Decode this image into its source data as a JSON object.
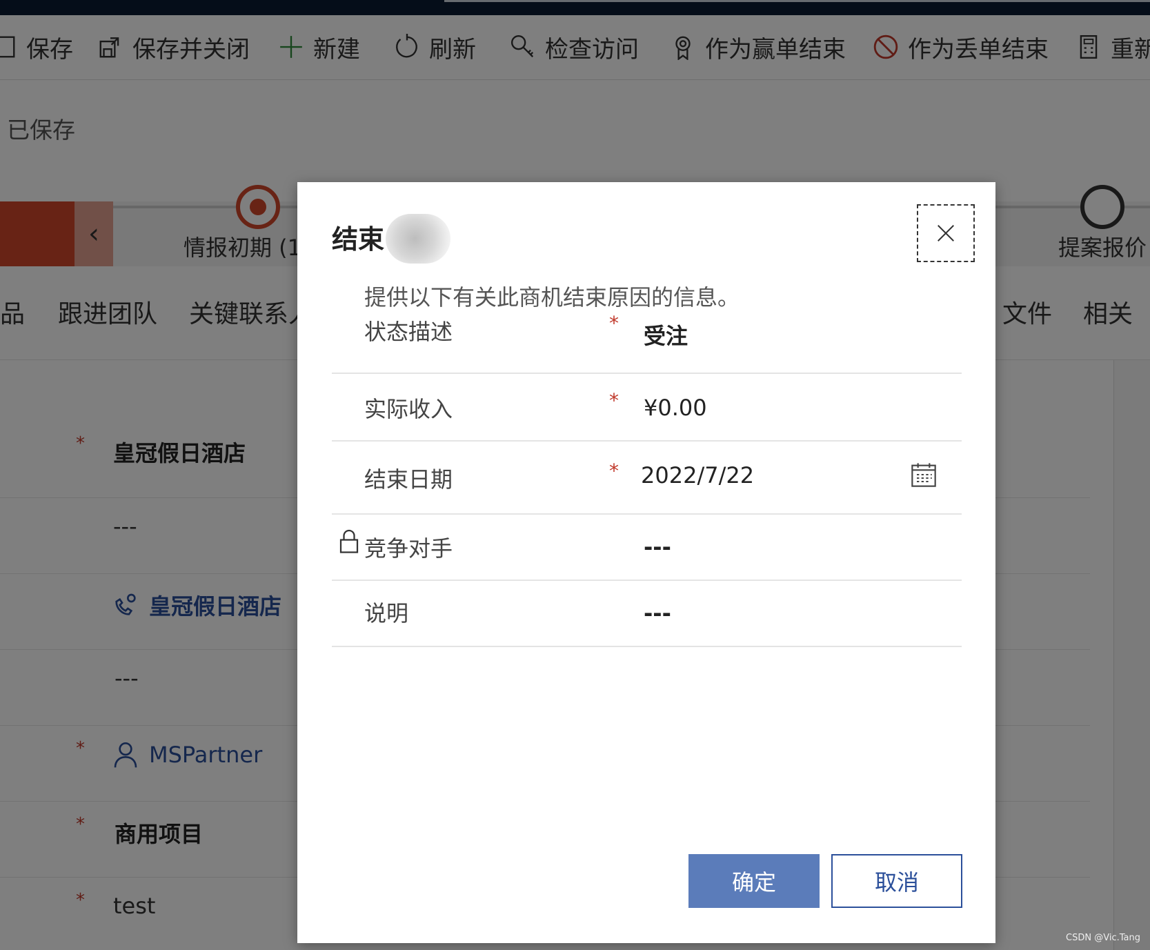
{
  "toolbar": {
    "items": [
      {
        "label": "保存",
        "icon": "save-icon"
      },
      {
        "label": "保存并关闭",
        "icon": "save-close-icon"
      },
      {
        "label": "新建",
        "icon": "plus-icon"
      },
      {
        "label": "刷新",
        "icon": "refresh-icon"
      },
      {
        "label": "检查访问",
        "icon": "key-icon"
      },
      {
        "label": "作为赢单结束",
        "icon": "award-icon"
      },
      {
        "label": "作为丢单结束",
        "icon": "prohibited-icon"
      },
      {
        "label": "重新",
        "icon": "calculator-icon"
      }
    ]
  },
  "header": {
    "saved_status": "已保存"
  },
  "stages": {
    "current_label": "情报初期 (1",
    "next_label": "提案报价",
    "prev_icon": "chevron-left-icon"
  },
  "tabs": [
    "品",
    "跟进团队",
    "关键联系人",
    "文件",
    "相关"
  ],
  "form": {
    "rows": [
      {
        "value": "皇冠假日酒店",
        "required": true
      },
      {
        "value": "---",
        "required": false
      },
      {
        "value": "皇冠假日酒店",
        "required": false,
        "icon": "account-icon"
      },
      {
        "value": "---",
        "required": false
      },
      {
        "value": "MSPartner",
        "required": true,
        "icon": "person-icon"
      },
      {
        "value": "商用项目",
        "required": true
      },
      {
        "value": "test",
        "required": true
      }
    ]
  },
  "dialog": {
    "title": "结束",
    "description": "提供以下有关此商机结束原因的信息。",
    "fields": [
      {
        "label": "状态描述",
        "value": "受注",
        "required": true
      },
      {
        "label": "实际收入",
        "value": "¥0.00",
        "required": true
      },
      {
        "label": "结束日期",
        "value": "2022/7/22",
        "required": true
      },
      {
        "label": "竞争对手",
        "value": "---",
        "required": false,
        "locked": true
      },
      {
        "label": "说明",
        "value": "---",
        "required": false
      }
    ],
    "required_mark": "*",
    "ok_label": "确定",
    "cancel_label": "取消",
    "colors": {
      "primary": "#5b7cba",
      "link": "#2b4f9a",
      "required": "#c0392b"
    }
  },
  "watermark": "CSDN @Vic.Tang"
}
